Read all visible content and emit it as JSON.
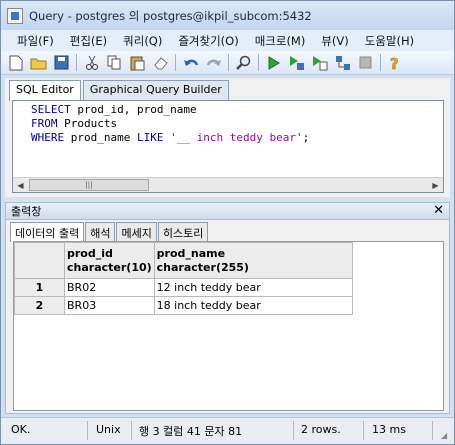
{
  "window": {
    "title": "Query - postgres 의 postgres@ikpil_subcom:5432"
  },
  "menu": [
    "파일(F)",
    "편집(E)",
    "쿼리(Q)",
    "즐겨찾기(O)",
    "매크로(M)",
    "뷰(V)",
    "도움말(H)"
  ],
  "toolbar_icons": [
    "new-file-icon",
    "open-folder-icon",
    "save-icon",
    "cut-icon",
    "copy-icon",
    "paste-icon",
    "eraser-icon",
    "undo-icon",
    "redo-icon",
    "find-icon",
    "execute-icon",
    "execute-pgscript-icon",
    "execute-to-file-icon",
    "explain-icon",
    "stop-icon",
    "help-icon"
  ],
  "editor": {
    "tabs": [
      "SQL Editor",
      "Graphical Query Builder"
    ],
    "line1_kw": "SELECT",
    "line1_rest": " prod_id, prod_name",
    "line2_kw": "FROM",
    "line2_rest": " Products",
    "line3_kw": "WHERE",
    "line3_mid": " prod_name ",
    "line3_kw2": "LIKE",
    "line3_sp": " ",
    "line3_str": "'__ inch teddy bear'",
    "line3_end": ";",
    "scroll_thumb": "|||"
  },
  "output": {
    "title": "출력창",
    "close": "✕",
    "tabs": [
      "데이터의 출력",
      "해석",
      "메세지",
      "히스토리"
    ],
    "columns": [
      {
        "name": "prod_id",
        "type": "character(10)"
      },
      {
        "name": "prod_name",
        "type": "character(255)"
      }
    ],
    "rows": [
      {
        "num": "1",
        "cells": [
          "BR02",
          "12 inch teddy bear"
        ]
      },
      {
        "num": "2",
        "cells": [
          "BR03",
          "18 inch teddy bear"
        ]
      }
    ]
  },
  "status": {
    "state": "OK.",
    "line_ending": "Unix",
    "position": "행 3 컬럼 41 문자 81",
    "rows": "2 rows.",
    "time": "13 ms"
  }
}
